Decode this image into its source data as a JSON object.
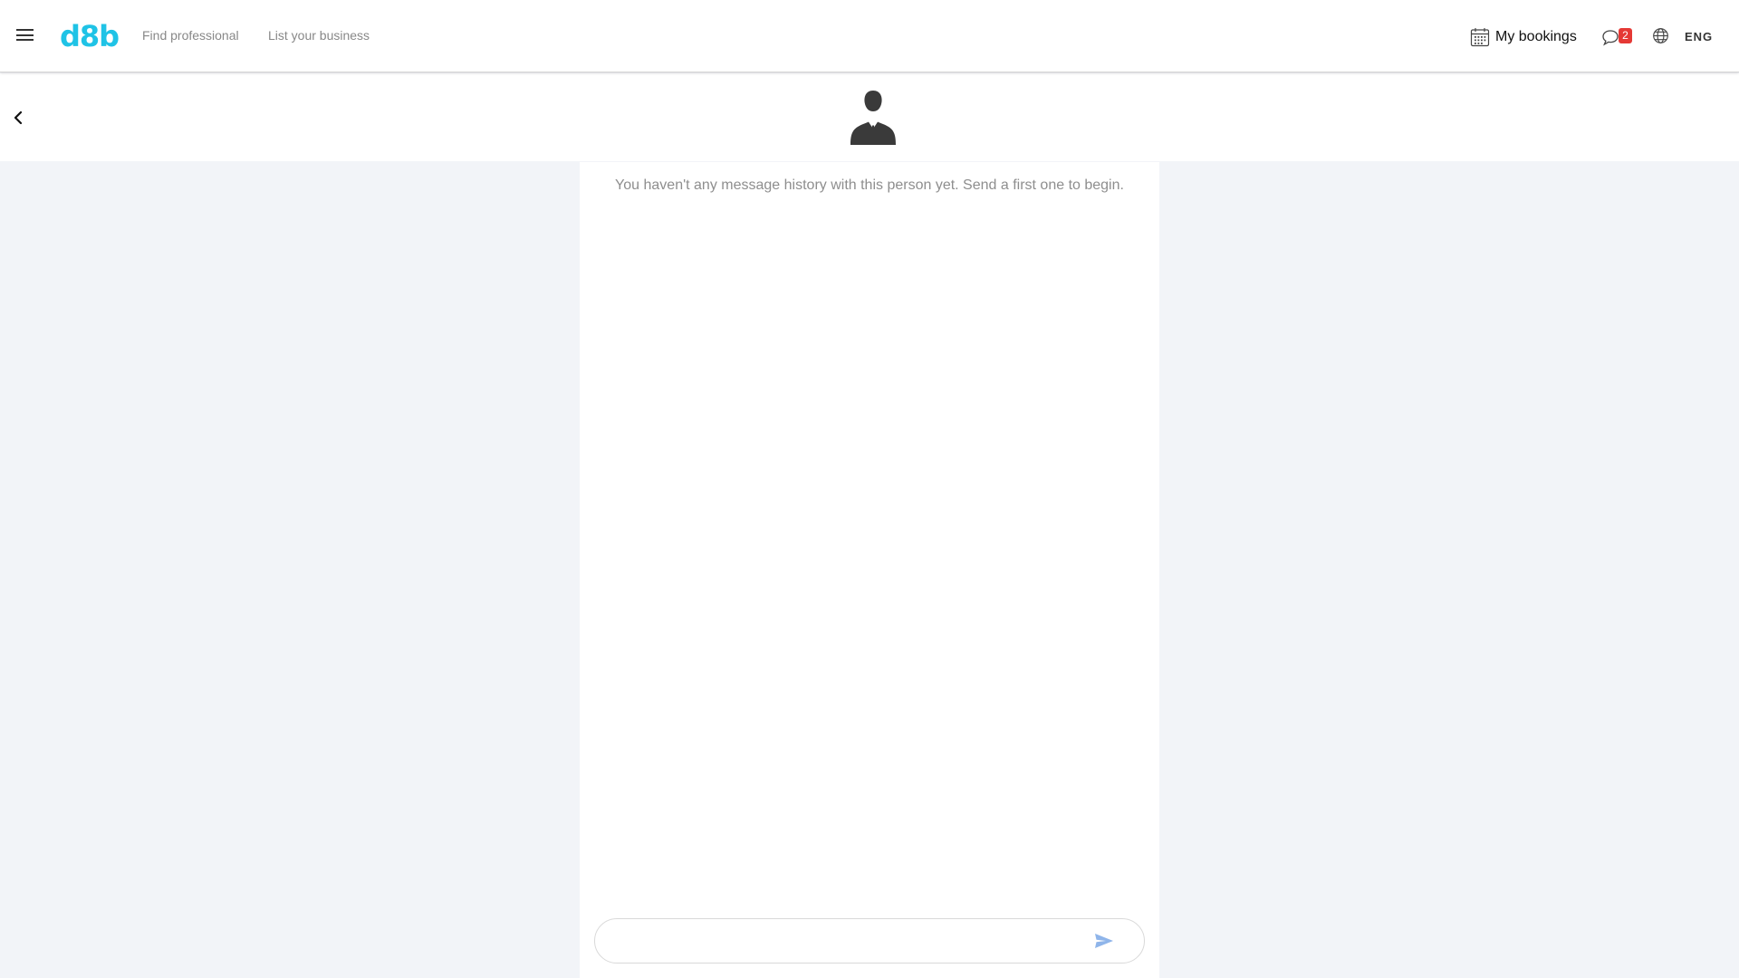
{
  "header": {
    "logo_text": "d8b",
    "nav": {
      "find_professional": "Find professional",
      "list_business": "List your business"
    },
    "my_bookings_label": "My bookings",
    "messages_badge_count": "2",
    "language": "ENG",
    "accent_color": "#1fc3e6",
    "badge_color": "#e53935"
  },
  "conversation": {
    "empty_state_text": "You haven't any message history with this person yet. Send a first one to begin.",
    "composer_placeholder": "",
    "composer_value": ""
  },
  "icons": {
    "menu": "hamburger-menu-icon",
    "calendar": "calendar-icon",
    "chat": "chat-bubble-icon",
    "globe": "globe-icon",
    "back": "chevron-left-icon",
    "avatar": "person-silhouette-avatar",
    "send": "send-arrow-icon"
  }
}
